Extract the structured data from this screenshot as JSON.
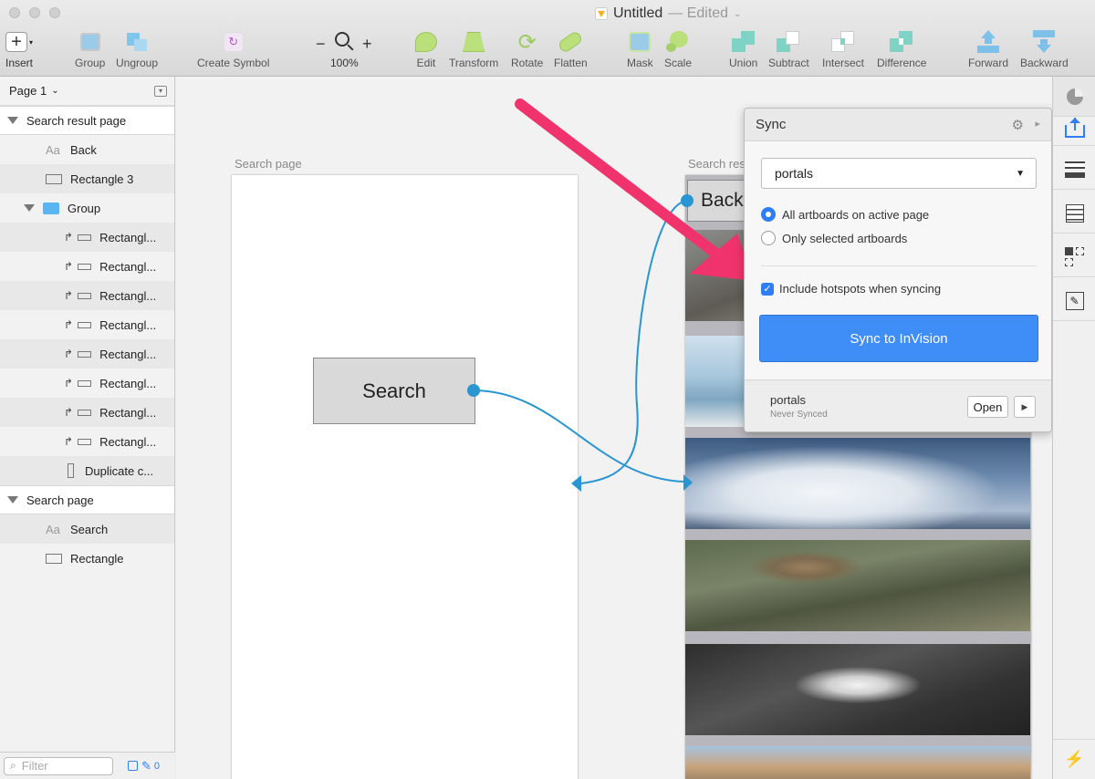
{
  "window": {
    "title": "Untitled",
    "status": "— Edited"
  },
  "toolbar": {
    "insert": "Insert",
    "group": "Group",
    "ungroup": "Ungroup",
    "create_symbol": "Create Symbol",
    "zoom_out": "−",
    "zoom_in": "+",
    "zoom": "100%",
    "edit": "Edit",
    "transform": "Transform",
    "rotate": "Rotate",
    "flatten": "Flatten",
    "mask": "Mask",
    "scale": "Scale",
    "union": "Union",
    "subtract": "Subtract",
    "intersect": "Intersect",
    "difference": "Difference",
    "forward": "Forward",
    "backward": "Backward"
  },
  "layers": {
    "page": "Page 1",
    "artboard1": {
      "name": "Search result page",
      "children": {
        "back": "Back",
        "rect3": "Rectangle 3",
        "group": "Group",
        "group_items": [
          "Rectangl...",
          "Rectangl...",
          "Rectangl...",
          "Rectangl...",
          "Rectangl...",
          "Rectangl...",
          "Rectangl...",
          "Rectangl..."
        ],
        "duplicate": "Duplicate c..."
      }
    },
    "artboard2": {
      "name": "Search page",
      "children": {
        "search": "Search",
        "rectangle": "Rectangle"
      }
    },
    "filter_placeholder": "Filter",
    "filter_count": "0"
  },
  "canvas": {
    "artboard_left_label": "Search page",
    "artboard_right_label": "Search res",
    "search_button": "Search",
    "back_button": "Back"
  },
  "sync": {
    "title": "Sync",
    "project": "portals",
    "radio_all": "All artboards on active page",
    "radio_selected": "Only selected artboards",
    "checkbox": "Include hotspots when syncing",
    "button": "Sync to InVision",
    "footer_project": "portals",
    "footer_status": "Never Synced",
    "open": "Open"
  },
  "colors": {
    "accent": "#3f8df6",
    "arrow": "#f0336c",
    "link": "#2a95d3"
  }
}
